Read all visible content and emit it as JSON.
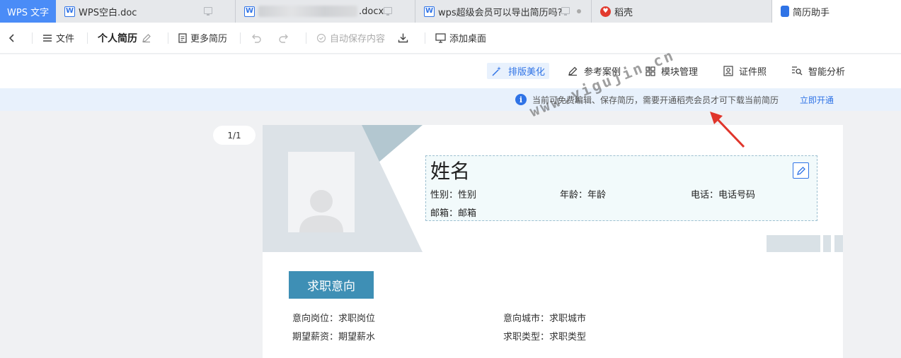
{
  "tabs": {
    "app": "WPS 文字",
    "items": [
      {
        "label": "WPS空白.doc"
      },
      {
        "label": ".docx"
      },
      {
        "label": "wps超级会员可以导出简历吗?"
      },
      {
        "label": "稻壳"
      },
      {
        "label": "简历助手"
      }
    ]
  },
  "toolbar": {
    "file": "文件",
    "doc_title": "个人简历",
    "more_resumes": "更多简历",
    "autosave": "自动保存内容",
    "add_desktop": "添加桌面"
  },
  "subbar": {
    "layout": "排版美化",
    "cases": "参考案例",
    "modules": "模块管理",
    "photo": "证件照",
    "analysis": "智能分析"
  },
  "notice": {
    "message": "当前可免费编辑、保存简历，需要开通稻壳会员才可下载当前简历",
    "action": "立即开通"
  },
  "pager": "1/1",
  "resume": {
    "name": "姓名",
    "gender": "性别：性别",
    "age": "年龄：年龄",
    "phone": "电话：电话号码",
    "email": "邮箱：邮箱",
    "section_title": "求职意向",
    "job_position": "意向岗位：求职岗位",
    "job_city": "意向城市：求职城市",
    "salary": "期望薪资：期望薪水",
    "job_type": "求职类型：求职类型"
  },
  "watermark": "www.yigujin.cn",
  "colors": {
    "accent": "#2f73e6",
    "section": "#3e8fb5",
    "arrow": "#e0352b"
  }
}
